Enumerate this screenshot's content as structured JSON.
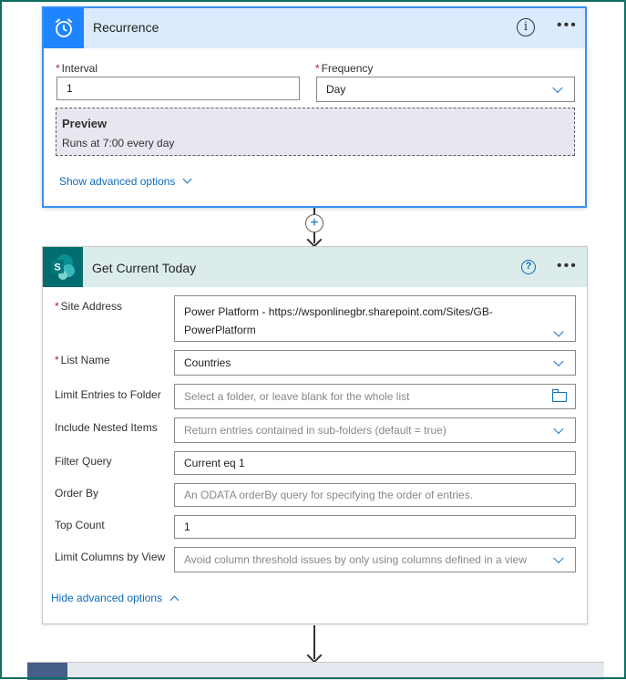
{
  "recurrence": {
    "title": "Recurrence",
    "interval_label": "Interval",
    "interval_value": "1",
    "frequency_label": "Frequency",
    "frequency_value": "Day",
    "preview_title": "Preview",
    "preview_text": "Runs at 7:00 every day",
    "show_advanced": "Show advanced options",
    "icon": "alarm-clock-icon",
    "accent_color": "#1f85ff"
  },
  "sharepoint": {
    "title": "Get Current Today",
    "icon": "sharepoint-icon",
    "accent_color": "#036c70",
    "fields": {
      "site_address": {
        "label": "Site Address",
        "value_line1": "Power Platform - https://wsponlinegbr.sharepoint.com/Sites/GB-",
        "value_line2": "PowerPlatform"
      },
      "list_name": {
        "label": "List Name",
        "value": "Countries"
      },
      "limit_folder": {
        "label": "Limit Entries to Folder",
        "placeholder": "Select a folder, or leave blank for the whole list"
      },
      "nested_items": {
        "label": "Include Nested Items",
        "placeholder": "Return entries contained in sub-folders (default = true)"
      },
      "filter_query": {
        "label": "Filter Query",
        "value": "Current eq 1"
      },
      "order_by": {
        "label": "Order By",
        "placeholder": "An ODATA orderBy query for specifying the order of entries."
      },
      "top_count": {
        "label": "Top Count",
        "value": "1"
      },
      "limit_columns": {
        "label": "Limit Columns by View",
        "placeholder": "Avoid column threshold issues by only using columns defined in a view"
      }
    },
    "hide_advanced": "Hide advanced options"
  },
  "required_marker": "*"
}
